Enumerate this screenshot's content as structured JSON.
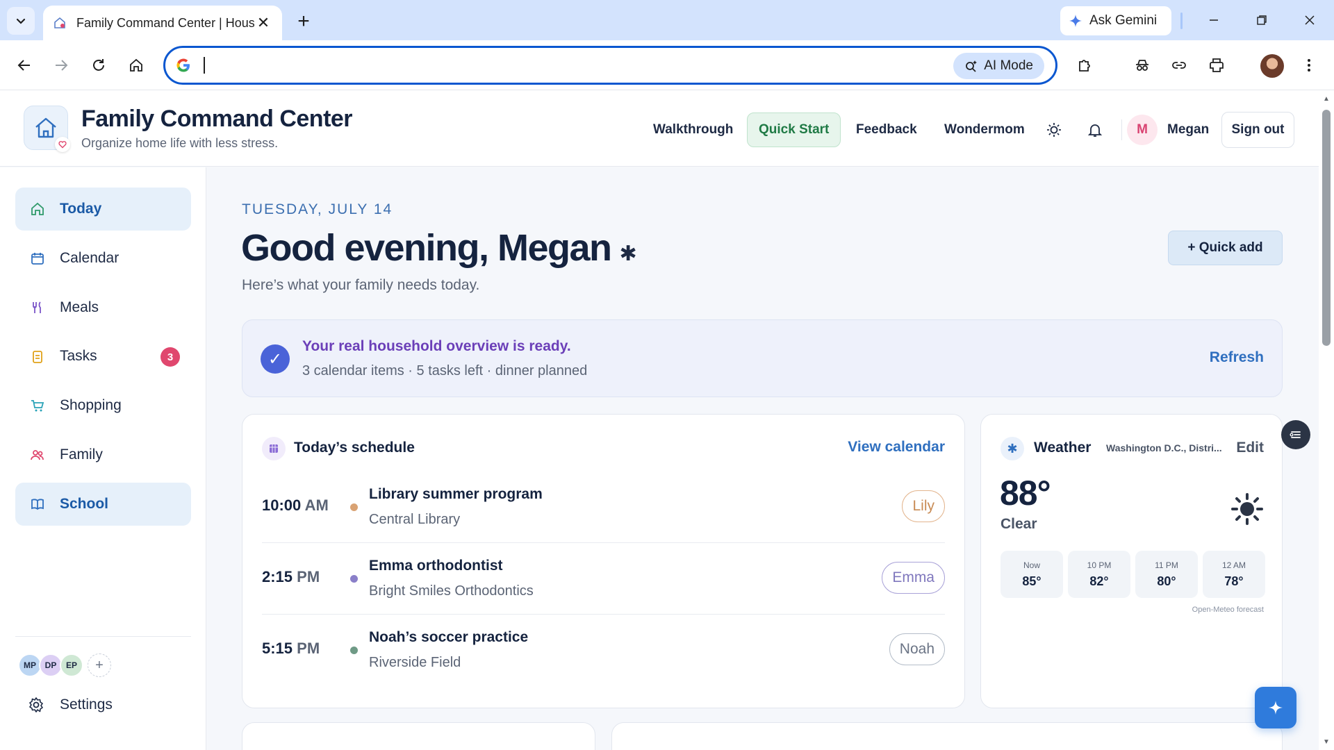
{
  "browser": {
    "tab_title": "Family Command Center | Hous",
    "new_tab_symbol": "+",
    "close_symbol": "✕",
    "gemini_label": "Ask Gemini",
    "ai_mode_label": "AI Mode",
    "omnibox_value": ""
  },
  "header": {
    "title": "Family Command Center",
    "subtitle": "Organize home life with less stress.",
    "nav": {
      "walkthrough": "Walkthrough",
      "quick_start": "Quick Start",
      "feedback": "Feedback",
      "wondermom": "Wondermom"
    },
    "user_initial": "M",
    "user_name": "Megan",
    "sign_out": "Sign out"
  },
  "sidebar": {
    "items": [
      {
        "label": "Today",
        "icon": "home-icon",
        "active": true
      },
      {
        "label": "Calendar",
        "icon": "calendar-icon"
      },
      {
        "label": "Meals",
        "icon": "utensils-icon"
      },
      {
        "label": "Tasks",
        "icon": "clipboard-icon",
        "badge": "3"
      },
      {
        "label": "Shopping",
        "icon": "cart-icon"
      },
      {
        "label": "Family",
        "icon": "people-icon"
      },
      {
        "label": "School",
        "icon": "book-icon",
        "active": true
      }
    ],
    "members": [
      "MP",
      "DP",
      "EP"
    ],
    "add_member": "+",
    "settings_label": "Settings"
  },
  "main": {
    "date": "TUESDAY, JULY 14",
    "greeting": "Good evening, Megan",
    "greeting_mark": "✱",
    "subheading": "Here’s what your family needs today.",
    "quick_add": "+ Quick add",
    "banner": {
      "title": "Your real household overview is ready.",
      "subtitle": "3 calendar items · 5 tasks left · dinner planned",
      "action": "Refresh"
    },
    "schedule": {
      "title": "Today’s schedule",
      "link": "View calendar",
      "events": [
        {
          "time": "10:00",
          "ampm": "AM",
          "title": "Library summer program",
          "location": "Central Library",
          "person": "Lily",
          "color": "#d9a273"
        },
        {
          "time": "2:15",
          "ampm": "PM",
          "title": "Emma orthodontist",
          "location": "Bright Smiles Orthodontics",
          "person": "Emma",
          "color": "#8a7fc9"
        },
        {
          "time": "5:15",
          "ampm": "PM",
          "title": "Noah’s soccer practice",
          "location": "Riverside Field",
          "person": "Noah",
          "color": "#6f9a86"
        }
      ]
    },
    "weather": {
      "title": "Weather",
      "location": "Washington D.C., Distri...",
      "edit": "Edit",
      "temp": "88°",
      "condition": "Clear",
      "hours": [
        {
          "label": "Now",
          "temp": "85°"
        },
        {
          "label": "10 PM",
          "temp": "82°"
        },
        {
          "label": "11 PM",
          "temp": "80°"
        },
        {
          "label": "12 AM",
          "temp": "78°"
        }
      ],
      "source": "Open-Meteo forecast"
    }
  },
  "colors": {
    "accent": "#2f6fbf",
    "active_bg": "#e6f0fa",
    "badge": "#e0476e",
    "banner_title": "#6b3fb8"
  }
}
